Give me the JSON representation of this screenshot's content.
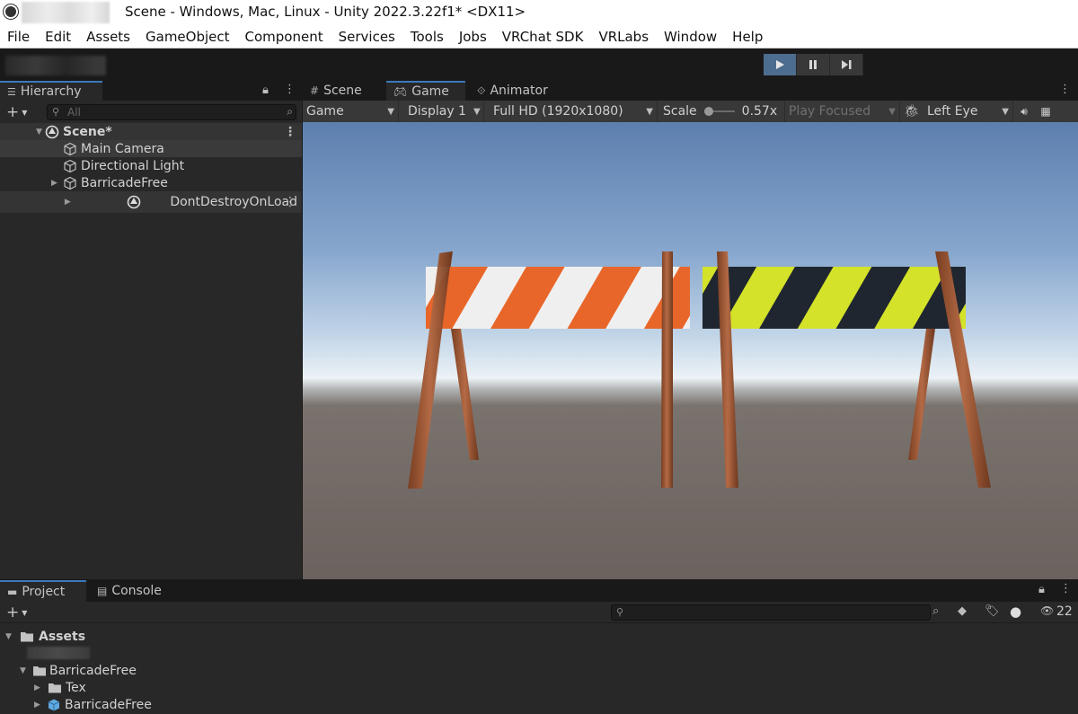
{
  "window": {
    "title": "Scene - Windows, Mac, Linux - Unity 2022.3.22f1* <DX11>"
  },
  "menu": [
    "File",
    "Edit",
    "Assets",
    "GameObject",
    "Component",
    "Services",
    "Tools",
    "Jobs",
    "VRChat SDK",
    "VRLabs",
    "Window",
    "Help"
  ],
  "hierarchy": {
    "tab_label": "Hierarchy",
    "search_placeholder": "All",
    "items": [
      {
        "label": "Scene*"
      },
      {
        "label": "Main Camera"
      },
      {
        "label": "Directional Light"
      },
      {
        "label": "BarricadeFree"
      },
      {
        "label": "DontDestroyOnLoad"
      }
    ]
  },
  "view_tabs": [
    "Scene",
    "Game",
    "Animator"
  ],
  "game_bar": {
    "mode": "Game",
    "display": "Display 1",
    "resolution": "Full HD (1920x1080)",
    "scale_label": "Scale",
    "scale_value": "0.57x",
    "play_focused": "Play Focused",
    "eye": "Left Eye"
  },
  "bottom_tabs": [
    "Project",
    "Console"
  ],
  "project": {
    "hidden_count": "22",
    "tree": [
      {
        "label": "Assets"
      },
      {
        "label": "BarricadeFree"
      },
      {
        "label": "Tex"
      },
      {
        "label": "BarricadeFree"
      }
    ]
  },
  "colors": {
    "accent": "#3a79bb",
    "play_active": "#4d6d8f",
    "panel": "#282828",
    "barricade_orange": "#e8662a",
    "barricade_yellow": "#d4e22a"
  }
}
